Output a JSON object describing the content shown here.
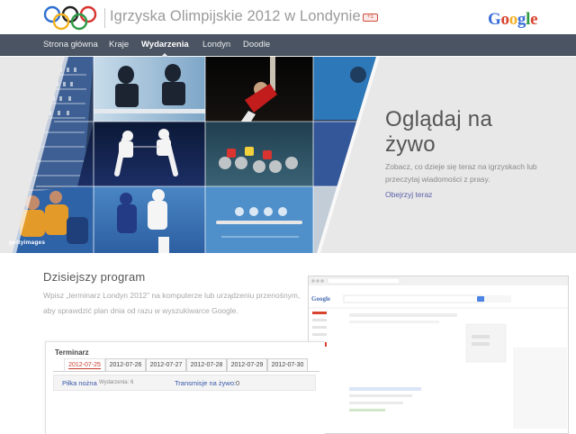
{
  "header": {
    "title": "Igrzyska Olimpijskie 2012 w Londynie",
    "gplus_badge": "+1",
    "google_logo": [
      "G",
      "o",
      "o",
      "g",
      "l",
      "e"
    ],
    "google_colors": [
      "#3b6fd6",
      "#d8432f",
      "#f2b227",
      "#3b6fd6",
      "#2f9b3e",
      "#d8432f"
    ]
  },
  "nav": {
    "items": [
      {
        "label": "Strona główna",
        "active": false
      },
      {
        "label": "Kraje",
        "active": false
      },
      {
        "label": "Wydarzenia",
        "active": true
      },
      {
        "label": "Londyn",
        "active": false
      },
      {
        "label": "Doodle",
        "active": false
      }
    ]
  },
  "hero": {
    "title_line1": "Oglądaj na",
    "title_line2": "żywo",
    "description": "Zobacz, co dzieje się teraz na igrzyskach lub przeczytaj wiadomości z prasy.",
    "link": "Obejrzyj teraz",
    "getty": "gettyimages"
  },
  "program": {
    "heading": "Dzisiejszy program",
    "text": "Wpisz „terminarz Londyn 2012” na komputerze lub urządzeniu przenośnym, aby sprawdzić plan dnia od razu w wyszukiwarce Google.",
    "browser_search_brand": "Google"
  },
  "schedule": {
    "title": "Terminarz",
    "dates": [
      "2012-07-25",
      "2012-07-26",
      "2012-07-27",
      "2012-07-28",
      "2012-07-29",
      "2012-07-30"
    ],
    "active_date_index": 0,
    "event_name": "Piłka nożna",
    "event_count": "Wydarzenia: 6",
    "live_label": "Transmisje na żywo:",
    "live_count": "0"
  },
  "colors": {
    "nav_bg": "#4b5462",
    "accent_red": "#c83a2b",
    "link_blue": "#3558a8"
  }
}
